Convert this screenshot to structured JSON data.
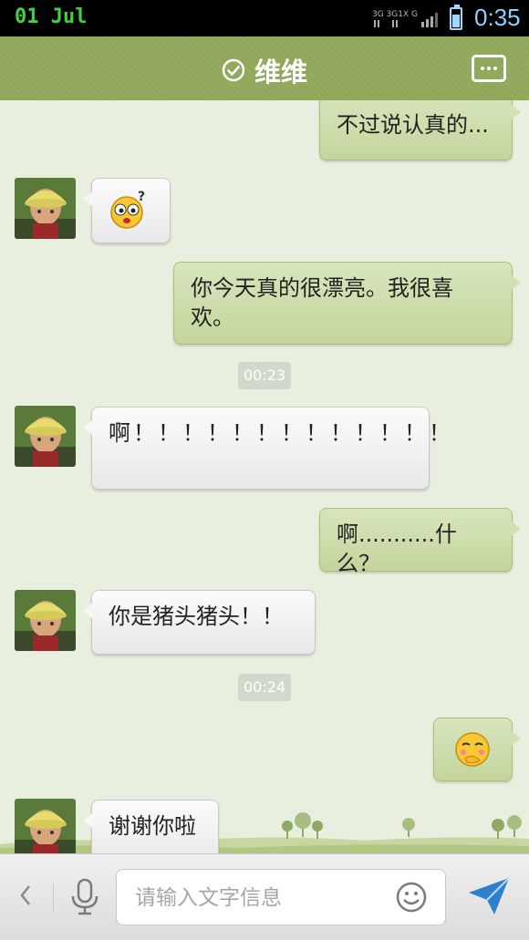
{
  "status_bar": {
    "date": "01 Jul",
    "time": "0:35"
  },
  "header": {
    "title": "维维"
  },
  "messages": [
    {
      "side": "right",
      "type": "text",
      "text": "不过说认真的..."
    },
    {
      "side": "left",
      "type": "emoji",
      "emoji": "confused-face"
    },
    {
      "side": "right",
      "type": "text",
      "text": "你今天真的很漂亮。我很喜欢。"
    },
    {
      "type": "time",
      "text": "00:23"
    },
    {
      "side": "left",
      "type": "text",
      "text": "啊！！！！！！！！！！！！！"
    },
    {
      "side": "right",
      "type": "text",
      "text": "啊...........什么？"
    },
    {
      "side": "left",
      "type": "text",
      "text": "你是猪头猪头！！"
    },
    {
      "type": "time",
      "text": "00:24"
    },
    {
      "side": "right",
      "type": "emoji",
      "emoji": "shy-face"
    },
    {
      "side": "left",
      "type": "text",
      "text": "谢谢你啦"
    }
  ],
  "input_bar": {
    "placeholder": "请输入文字信息"
  },
  "colors": {
    "header": "#91a85b",
    "chat_bg": "#e9efdf",
    "bubble_right": "#c8d9a4",
    "bubble_left": "#f5f5f5",
    "send": "#2f7fd1"
  }
}
